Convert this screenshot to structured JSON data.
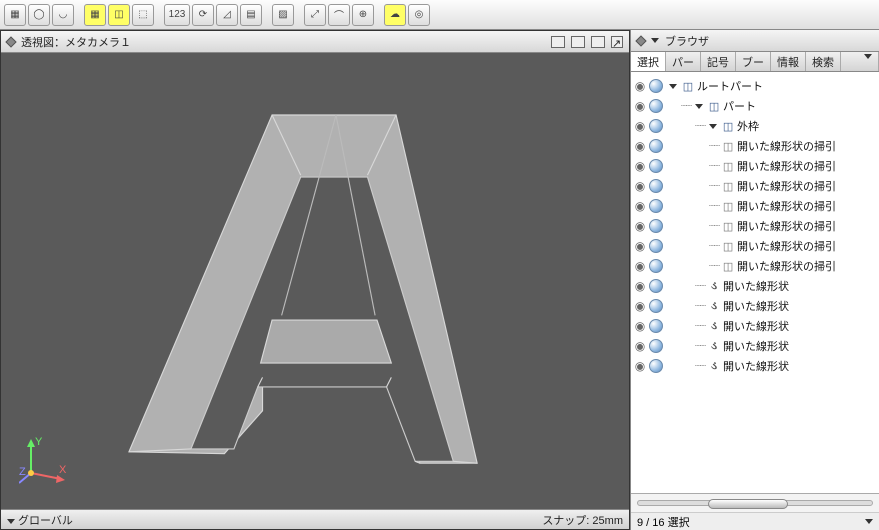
{
  "toolbar": {
    "buttons": [
      {
        "name": "wire-icon",
        "glyph": "▦",
        "hl": false
      },
      {
        "name": "cylinder-icon",
        "glyph": "◯",
        "hl": false
      },
      {
        "name": "surface-icon",
        "glyph": "◡",
        "hl": false
      },
      {
        "name": "grid-icon",
        "glyph": "▦",
        "hl": true
      },
      {
        "name": "cube-icon",
        "glyph": "◫",
        "hl": true
      },
      {
        "name": "size-icon",
        "glyph": "⬚",
        "hl": false
      },
      {
        "name": "dim-icon",
        "glyph": "123",
        "hl": false
      },
      {
        "name": "rotate-icon",
        "glyph": "⟳",
        "hl": false
      },
      {
        "name": "angle-icon",
        "glyph": "◿",
        "hl": false
      },
      {
        "name": "layers-icon",
        "glyph": "▤",
        "hl": false
      },
      {
        "name": "hatch-icon",
        "glyph": "▨",
        "hl": false
      },
      {
        "name": "snap-icon",
        "glyph": "⤢",
        "hl": false
      },
      {
        "name": "bridge-icon",
        "glyph": "⌒",
        "hl": false
      },
      {
        "name": "globe-icon",
        "glyph": "⊕",
        "hl": false
      },
      {
        "name": "cloud-icon",
        "glyph": "☁",
        "hl": true
      },
      {
        "name": "target-icon",
        "glyph": "◎",
        "hl": false
      }
    ]
  },
  "viewport": {
    "title": "透視図：メタカメラ１",
    "footer_left": "グローバル",
    "footer_right": "スナップ: 25mm",
    "axes": {
      "x": "X",
      "y": "Y",
      "z": "Z"
    }
  },
  "browser": {
    "title": "ブラウザ",
    "tabs": [
      "選択",
      "パー",
      "記号",
      "ブー",
      "情報",
      "検索"
    ],
    "tree": [
      {
        "depth": 0,
        "disc": true,
        "icon": "cube",
        "label": "ルートパート"
      },
      {
        "depth": 1,
        "disc": true,
        "icon": "cube",
        "label": "パート"
      },
      {
        "depth": 2,
        "disc": true,
        "icon": "cube",
        "label": "外枠"
      },
      {
        "depth": 3,
        "icon": "greyc",
        "label": "開いた線形状の掃引"
      },
      {
        "depth": 3,
        "icon": "greyc",
        "label": "開いた線形状の掃引"
      },
      {
        "depth": 3,
        "icon": "greyc",
        "label": "開いた線形状の掃引"
      },
      {
        "depth": 3,
        "icon": "greyc",
        "label": "開いた線形状の掃引"
      },
      {
        "depth": 3,
        "icon": "greyc",
        "label": "開いた線形状の掃引"
      },
      {
        "depth": 3,
        "icon": "greyc",
        "label": "開いた線形状の掃引"
      },
      {
        "depth": 3,
        "icon": "greyc",
        "label": "開いた線形状の掃引"
      },
      {
        "depth": 2,
        "icon": "curve",
        "label": "開いた線形状"
      },
      {
        "depth": 2,
        "icon": "curve",
        "label": "開いた線形状"
      },
      {
        "depth": 2,
        "icon": "curve",
        "label": "開いた線形状"
      },
      {
        "depth": 2,
        "icon": "curve",
        "label": "開いた線形状"
      },
      {
        "depth": 2,
        "icon": "curve",
        "label": "開いた線形状"
      }
    ],
    "status": "9 / 16  選択"
  }
}
